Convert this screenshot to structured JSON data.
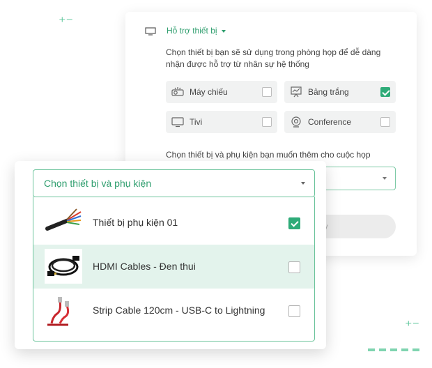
{
  "support": {
    "title": "Hỗ trợ thiết bị",
    "description": "Chọn thiết bị bạn sẽ sử dụng trong phòng họp để dễ dàng nhận được hỗ trợ từ nhân sự hệ thống",
    "devices": [
      {
        "label": "Máy chiếu",
        "icon": "projector-icon",
        "checked": false
      },
      {
        "label": "Bảng trắng",
        "icon": "whiteboard-icon",
        "checked": true
      },
      {
        "label": "Tivi",
        "icon": "tv-icon",
        "checked": false
      },
      {
        "label": "Conference",
        "icon": "webcam-icon",
        "checked": false
      }
    ],
    "accessory_prompt": "Chọn thiết bị và phụ kiện bạn muốn thêm cho cuộc họp",
    "cancel_label": "ủy"
  },
  "dropdown": {
    "selected_text": "Chọn thiết bị và phụ kiện",
    "options": [
      {
        "label": "Thiết bị phụ kiện 01",
        "icon": "cable-bundle-image",
        "checked": true
      },
      {
        "label": "HDMI Cables - Đen thui",
        "icon": "hdmi-cable-image",
        "checked": false,
        "highlighted": true
      },
      {
        "label": "Strip Cable 120cm - USB-C to Lightning",
        "icon": "red-usb-cable-image",
        "checked": false
      }
    ]
  },
  "colors": {
    "accent": "#2eab78",
    "accent_text": "#2f9e6e",
    "highlight_row": "#e3f3ec",
    "panel_grey": "#f1f2f2"
  }
}
